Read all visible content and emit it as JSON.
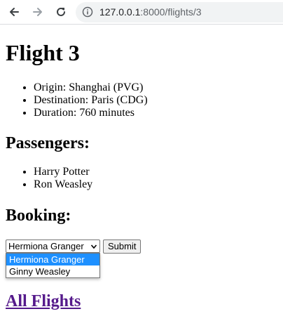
{
  "browser": {
    "url_host": "127.0.0.1",
    "url_path": ":8000/flights/3"
  },
  "page": {
    "title": "Flight 3",
    "details": [
      "Origin: Shanghai (PVG)",
      "Destination: Paris (CDG)",
      "Duration: 760 minutes"
    ],
    "passengers_heading": "Passengers:",
    "passengers": [
      "Harry Potter",
      "Ron Weasley"
    ],
    "booking_heading": "Booking:",
    "booking_select_value": "Hermiona Granger",
    "booking_options": [
      "Hermiona Granger",
      "Ginny Weasley"
    ],
    "submit_label": "Submit",
    "all_flights_link": "All Flights"
  },
  "colors": {
    "link_visited": "#551a8b",
    "option_highlight": "#1e90ff"
  }
}
